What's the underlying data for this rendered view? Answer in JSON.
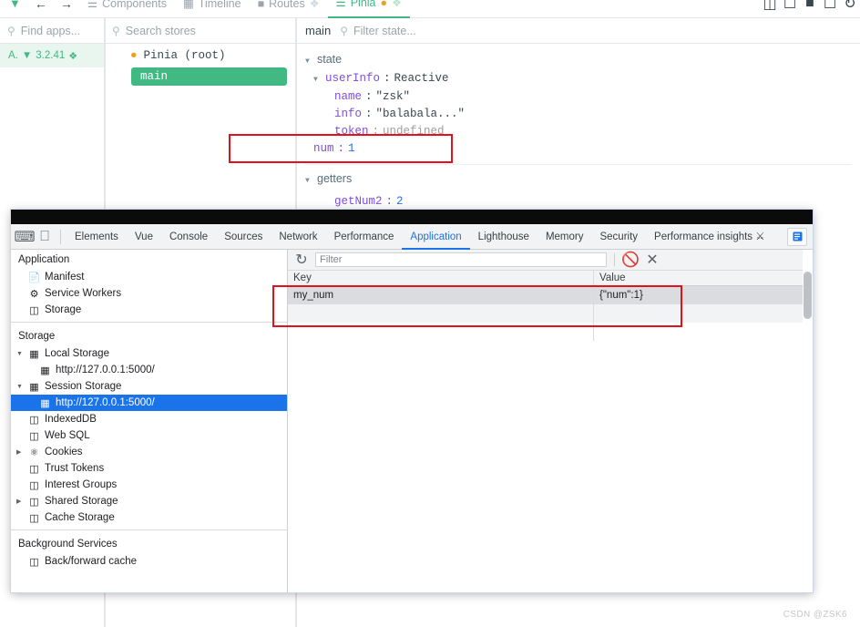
{
  "vue_devtools": {
    "logo_icon": "vue-logo-icon",
    "nav": {
      "back_icon": "arrow-back-icon",
      "forward_icon": "arrow-forward-icon"
    },
    "tabs": [
      {
        "label": "Components",
        "icon": "components-icon",
        "active": false
      },
      {
        "label": "Timeline",
        "icon": "timeline-icon",
        "active": false
      },
      {
        "label": "Routes",
        "icon": "routes-icon",
        "active": false
      },
      {
        "label": "Pinia",
        "icon": "pinia-icon",
        "active": true
      }
    ],
    "right_icons": [
      "sidebar-layout-icon",
      "panel-layout-icon",
      "dark-mode-icon",
      "window-layout-icon",
      "refresh-icon"
    ],
    "apps_panel": {
      "search_placeholder": "Find apps...",
      "selected_app": {
        "name": "A.",
        "version": "3.2.41",
        "vue_icon": "vue-logo-icon",
        "badge_icon": "alert-badge-icon"
      }
    },
    "stores_panel": {
      "search_placeholder": "Search stores",
      "root_label": "Pinia (root)",
      "root_icon": "pinia-icon",
      "stores": [
        {
          "label": "main",
          "selected": true
        }
      ]
    },
    "state_panel": {
      "title": "main",
      "filter_placeholder": "Filter state...",
      "groups": [
        {
          "name": "state",
          "expanded": true,
          "rows": [
            {
              "indent": 1,
              "arrow": true,
              "key": "userInfo",
              "sep": ":",
              "value": "Reactive",
              "value_type": "type"
            },
            {
              "indent": 2,
              "arrow": false,
              "key": "name",
              "sep": ":",
              "value": "\"zsk\"",
              "value_type": "string"
            },
            {
              "indent": 2,
              "arrow": false,
              "key": "info",
              "sep": ":",
              "value": "\"balabala...\"",
              "value_type": "string"
            },
            {
              "indent": 2,
              "arrow": false,
              "key": "token",
              "sep": ":",
              "value": "undefined",
              "value_type": "undefined"
            },
            {
              "indent": 1,
              "arrow": false,
              "key": "num",
              "sep": ":",
              "value": "1",
              "value_type": "number"
            }
          ]
        },
        {
          "name": "getters",
          "expanded": true,
          "rows": [
            {
              "indent": 1,
              "arrow": false,
              "key": "getNum2",
              "sep": ":",
              "value": "2",
              "value_type": "number"
            }
          ]
        }
      ]
    }
  },
  "chrome_devtools": {
    "toolbar_icons": [
      "inspect-element-icon",
      "device-toolbar-icon"
    ],
    "tabs": [
      {
        "label": "Elements",
        "active": false
      },
      {
        "label": "Vue",
        "active": false
      },
      {
        "label": "Console",
        "active": false
      },
      {
        "label": "Sources",
        "active": false
      },
      {
        "label": "Network",
        "active": false
      },
      {
        "label": "Performance",
        "active": false
      },
      {
        "label": "Application",
        "active": true
      },
      {
        "label": "Lighthouse",
        "active": false
      },
      {
        "label": "Memory",
        "active": false
      },
      {
        "label": "Security",
        "active": false
      },
      {
        "label": "Performance insights",
        "active": false,
        "suffix_icon": "beaker-icon"
      }
    ],
    "right_button_icon": "devtools-drawer-icon",
    "sidebar": {
      "sections": [
        {
          "title": "Application",
          "items": [
            {
              "label": "Manifest",
              "icon": "manifest-icon",
              "indent": 1,
              "expander": "none",
              "selected": false
            },
            {
              "label": "Service Workers",
              "icon": "gear-icon",
              "indent": 1,
              "expander": "none",
              "selected": false
            },
            {
              "label": "Storage",
              "icon": "database-icon",
              "indent": 1,
              "expander": "none",
              "selected": false
            }
          ]
        },
        {
          "title": "Storage",
          "items": [
            {
              "label": "Local Storage",
              "icon": "table-icon",
              "indent": 1,
              "expander": "expanded",
              "selected": false
            },
            {
              "label": "http://127.0.0.1:5000/",
              "icon": "table-icon",
              "indent": 2,
              "expander": "none",
              "selected": false
            },
            {
              "label": "Session Storage",
              "icon": "table-icon",
              "indent": 1,
              "expander": "expanded",
              "selected": false
            },
            {
              "label": "http://127.0.0.1:5000/",
              "icon": "table-icon",
              "indent": 2,
              "expander": "none",
              "selected": true
            },
            {
              "label": "IndexedDB",
              "icon": "database-icon",
              "indent": 1,
              "expander": "none",
              "selected": false
            },
            {
              "label": "Web SQL",
              "icon": "database-icon",
              "indent": 1,
              "expander": "none",
              "selected": false
            },
            {
              "label": "Cookies",
              "icon": "cookie-icon",
              "indent": 1,
              "expander": "collapsed",
              "selected": false
            },
            {
              "label": "Trust Tokens",
              "icon": "database-icon",
              "indent": 1,
              "expander": "none",
              "selected": false
            },
            {
              "label": "Interest Groups",
              "icon": "database-icon",
              "indent": 1,
              "expander": "none",
              "selected": false
            },
            {
              "label": "Shared Storage",
              "icon": "database-icon",
              "indent": 1,
              "expander": "collapsed",
              "selected": false
            },
            {
              "label": "Cache Storage",
              "icon": "database-icon",
              "indent": 1,
              "expander": "none",
              "selected": false
            }
          ]
        },
        {
          "title": "Background Services",
          "items": [
            {
              "label": "Back/forward cache",
              "icon": "database-icon",
              "indent": 1,
              "expander": "none",
              "selected": false
            }
          ]
        }
      ]
    },
    "storage_view": {
      "refresh_icon": "refresh-icon",
      "filter_placeholder": "Filter",
      "clear_all_icon": "clear-all-icon",
      "delete_selected_icon": "delete-icon",
      "columns": [
        "Key",
        "Value"
      ],
      "rows": [
        {
          "key": "my_num",
          "value": "{\"num\":1}",
          "selected": true
        },
        {
          "key": "",
          "value": ""
        }
      ]
    }
  },
  "annotations": {
    "state_box": {
      "color": "#e1121c"
    },
    "table_box": {
      "color": "#e1121c"
    }
  },
  "watermark": {
    "text": "CSDN @ZSK6"
  }
}
